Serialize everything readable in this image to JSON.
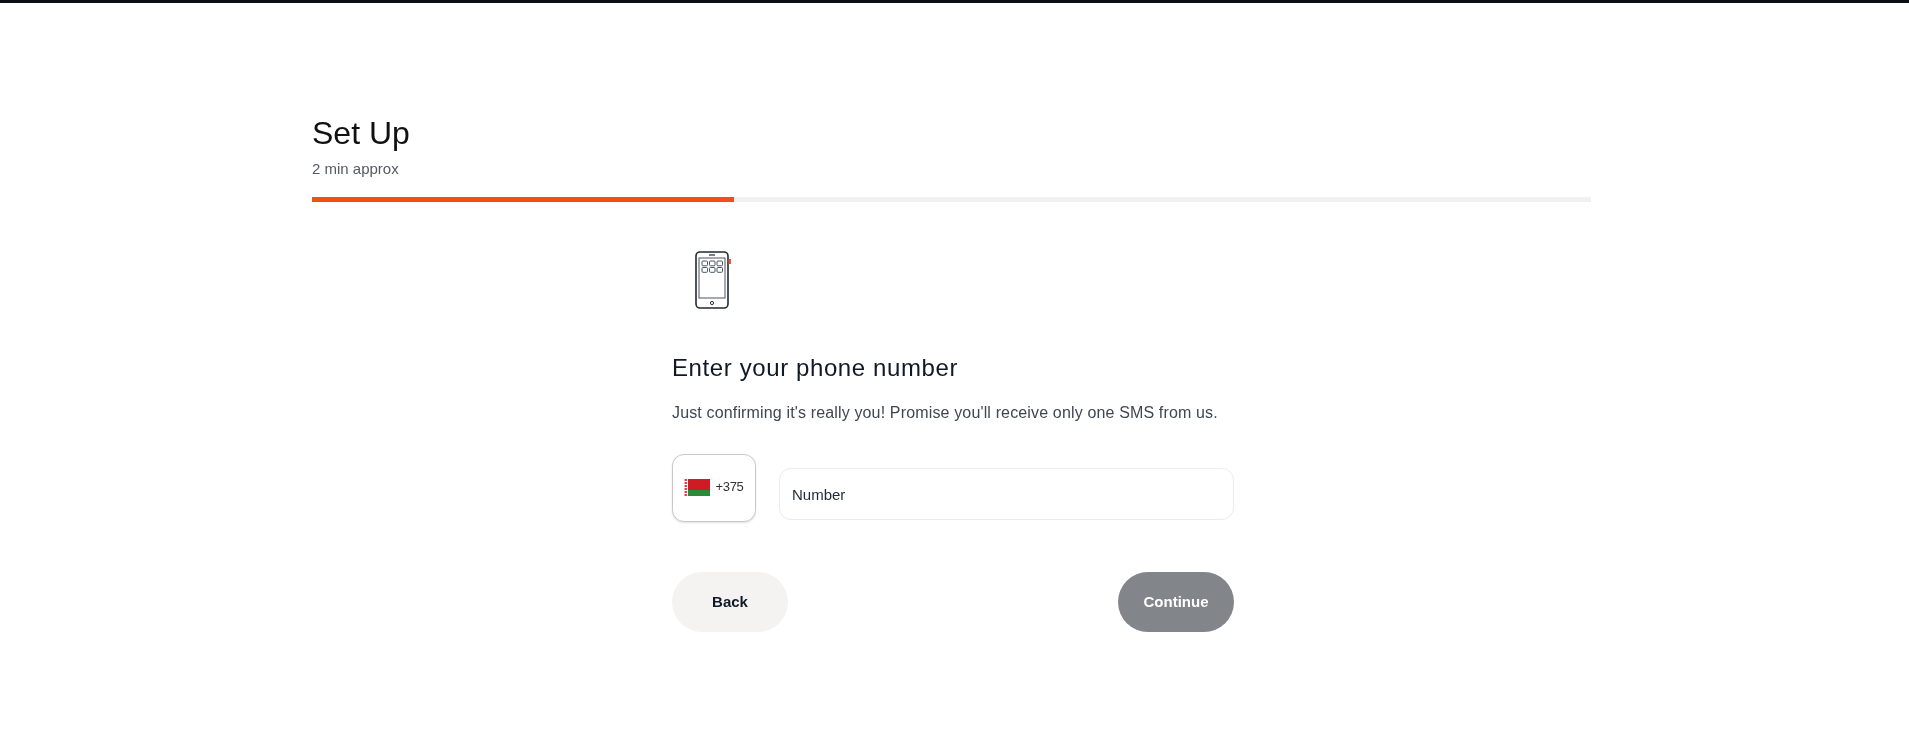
{
  "header": {
    "title": "Set Up",
    "subtitle": "2 min approx"
  },
  "progress": {
    "level": 0.33
  },
  "step": {
    "heading": "Enter your phone number",
    "description": "Just confirming it's really you! Promise you'll receive only one SMS from us."
  },
  "country_picker": {
    "code": "+375"
  },
  "phone_field": {
    "placeholder": "Number"
  },
  "buttons": [
    {
      "label": "Back",
      "kind": "secondary",
      "disabled": false
    },
    {
      "label": "Continue",
      "kind": "primary",
      "disabled": true
    }
  ]
}
